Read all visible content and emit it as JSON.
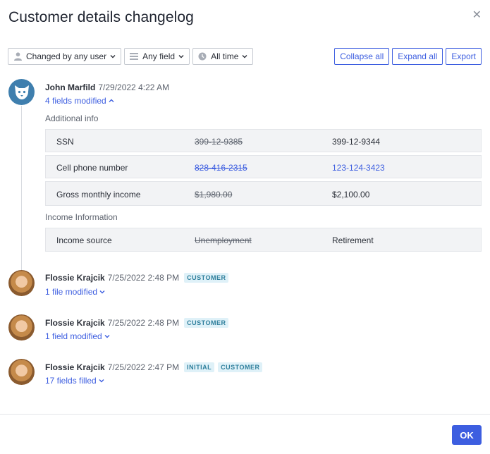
{
  "dialog": {
    "title": "Customer details changelog"
  },
  "filters": {
    "changed_by": "Changed by any user",
    "field": "Any field",
    "time": "All time"
  },
  "actions": {
    "collapse": "Collapse all",
    "expand": "Expand all",
    "export": "Export"
  },
  "entries": [
    {
      "name": "John Marfild",
      "date": "7/29/2022 4:22 AM",
      "toggle": "4 fields modified",
      "sections": [
        {
          "label": "Additional info",
          "rows": [
            {
              "field": "SSN",
              "old": "399-12-9385",
              "new": "399-12-9344"
            },
            {
              "field": "Cell phone number",
              "old": "828-416-2315",
              "new": "123-124-3423"
            },
            {
              "field": "Gross monthly income",
              "old": "$1,980.00",
              "new": "$2,100.00"
            }
          ]
        },
        {
          "label": "Income Information",
          "rows": [
            {
              "field": "Income source",
              "old": "Unemployment",
              "new": "Retirement"
            }
          ]
        }
      ]
    },
    {
      "name": "Flossie Krajcik",
      "date": "7/25/2022 2:48 PM",
      "tags": [
        "CUSTOMER"
      ],
      "toggle": "1 file modified"
    },
    {
      "name": "Flossie Krajcik",
      "date": "7/25/2022 2:48 PM",
      "tags": [
        "CUSTOMER"
      ],
      "toggle": "1 field modified"
    },
    {
      "name": "Flossie Krajcik",
      "date": "7/25/2022 2:47 PM",
      "tags": [
        "INITIAL",
        "CUSTOMER"
      ],
      "toggle": "17 fields filled"
    }
  ],
  "footer": {
    "ok": "OK"
  },
  "colors": {
    "accent": "#3d5ee0",
    "tag_bg": "#dff1f8",
    "tag_text": "#2f7f9c",
    "system_avatar": "#3f7fae"
  },
  "icons": {
    "close": "close-icon",
    "user": "user-icon",
    "field": "list-icon",
    "time": "clock-icon",
    "system_avatar": "wolf-logo-icon"
  }
}
